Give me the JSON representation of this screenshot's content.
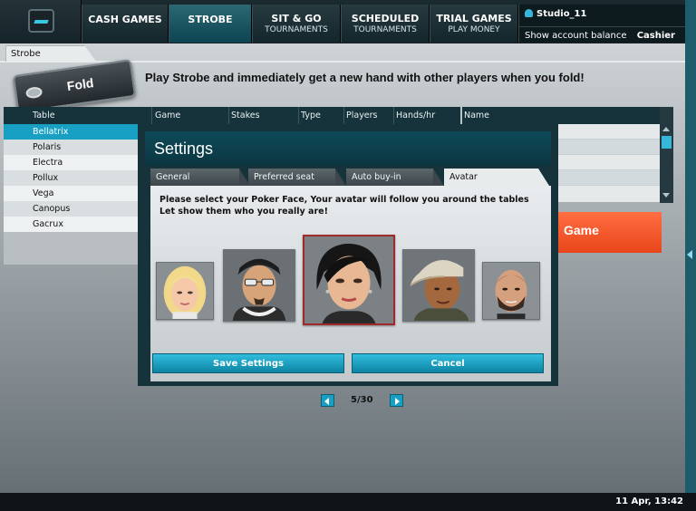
{
  "nav": {
    "tabs": [
      {
        "line1": "CASH GAMES",
        "line2": ""
      },
      {
        "line1": "STROBE",
        "line2": ""
      },
      {
        "line1": "SIT & GO",
        "line2": "TOURNAMENTS"
      },
      {
        "line1": "SCHEDULED",
        "line2": "TOURNAMENTS"
      },
      {
        "line1": "TRIAL GAMES",
        "line2": "PLAY MONEY"
      }
    ],
    "active_tab": "STROBE"
  },
  "account": {
    "username": "Studio_11",
    "show_balance": "Show account balance",
    "cashier": "Cashier"
  },
  "subtab": {
    "label": "Strobe"
  },
  "fold_button": {
    "label": "Fold"
  },
  "promo_text": "Play Strobe and immediately get a new hand with other players when you fold!",
  "list": {
    "columns": [
      "Table",
      "Game",
      "Stakes",
      "Type",
      "Players",
      "Hands/hr"
    ],
    "rows": [
      "Bellatrix",
      "Polaris",
      "Electra",
      "Pollux",
      "Vega",
      "Canopus",
      "Gacrux"
    ],
    "selected": "Bellatrix"
  },
  "players_panel": {
    "column": "Name"
  },
  "game_button": {
    "label": "Game"
  },
  "settings": {
    "title": "Settings",
    "tabs": [
      "General",
      "Preferred seat",
      "Auto buy-in",
      "Avatar"
    ],
    "active_tab": "Avatar",
    "instruction_1": "Please select your Poker Face, Your avatar will follow you around the tables",
    "instruction_2": "Let show them who you really are!",
    "avatars": [
      "blonde-woman-avatar",
      "man-with-glasses-avatar",
      "dark-haired-woman-avatar",
      "man-with-cap-avatar",
      "bald-bearded-man-avatar"
    ],
    "selected_avatar_index": 2,
    "pager_text": "5/30",
    "save_label": "Save Settings",
    "cancel_label": "Cancel"
  },
  "clock": "11 Apr, 13:42",
  "colors": {
    "accent": "#17a0c4",
    "game_button": "#f05a2a",
    "selection_border": "#9f2a2a"
  }
}
